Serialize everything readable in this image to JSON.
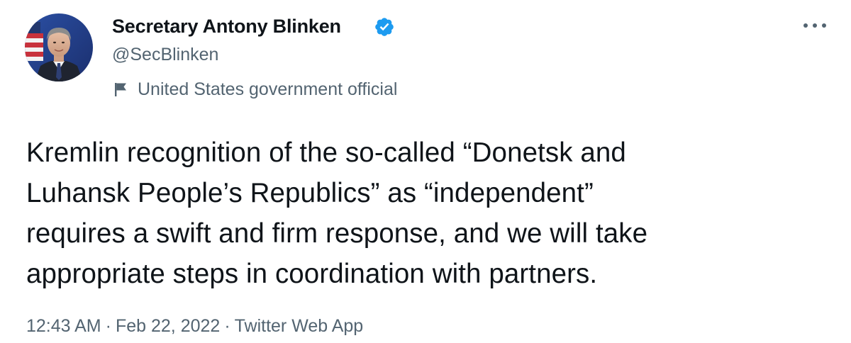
{
  "author": {
    "display_name": "Secretary Antony Blinken",
    "handle": "@SecBlinken",
    "affiliation": "United States government official",
    "avatar_icon": "avatar-photo",
    "verified_icon": "verified-badge-icon",
    "verified_color": "#1d9bf0"
  },
  "menu": {
    "more_icon": "more-horizontal-icon"
  },
  "tweet": {
    "text_lines": [
      "Kremlin recognition of the so-called “Donetsk and",
      "Luhansk People’s Republics” as “independent”",
      "requires a swift and firm response, and we will take",
      "appropriate steps in coordination with partners."
    ]
  },
  "meta": {
    "time": "12:43 AM",
    "separator": "·",
    "date": "Feb 22, 2022",
    "source": "Twitter Web App"
  },
  "colors": {
    "text": "#0f1419",
    "secondary": "#536471",
    "accent": "#1d9bf0"
  }
}
